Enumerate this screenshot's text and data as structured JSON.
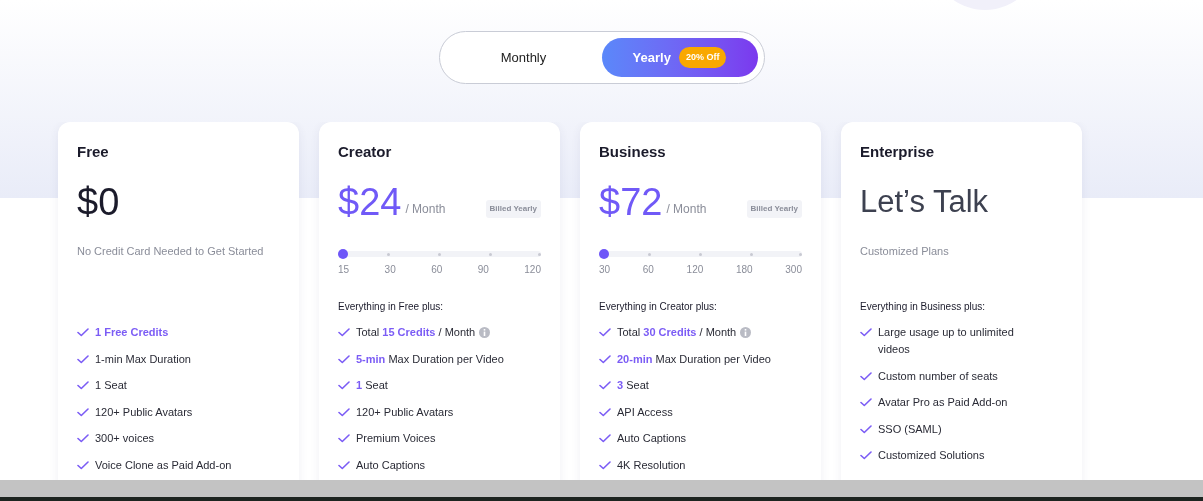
{
  "billing_toggle": {
    "options": [
      {
        "label": "Monthly",
        "selected": false
      },
      {
        "label": "Yearly",
        "selected": true,
        "badge": "20% Off"
      }
    ]
  },
  "plans": [
    {
      "name": "Free",
      "price": {
        "kind": "amount",
        "currency": "$",
        "amount": "0"
      },
      "subtitle": "No Credit Card Needed to Get Started",
      "features": [
        {
          "parts": [
            {
              "text": "1 Free Credits",
              "highlight": true
            }
          ]
        },
        {
          "parts": [
            {
              "text": "1-min Max Duration"
            }
          ]
        },
        {
          "parts": [
            {
              "text": "1 Seat"
            }
          ]
        },
        {
          "parts": [
            {
              "text": "120+ Public Avatars"
            }
          ]
        },
        {
          "parts": [
            {
              "text": "300+ voices"
            }
          ]
        },
        {
          "parts": [
            {
              "text": "Voice Clone as Paid Add-on"
            }
          ]
        }
      ]
    },
    {
      "name": "Creator",
      "price": {
        "kind": "amount",
        "currency": "$",
        "amount": "24",
        "period": "/ Month",
        "note": "Billed Yearly",
        "highlight": true
      },
      "slider": {
        "level": 0,
        "labels": [
          "15",
          "30",
          "60",
          "90",
          "120"
        ]
      },
      "includes": "Everything in Free plus:",
      "features": [
        {
          "parts": [
            {
              "text": "Total "
            },
            {
              "text": "15 Credits",
              "highlight": true
            },
            {
              "text": " / Month"
            }
          ],
          "info": true
        },
        {
          "parts": [
            {
              "text": "5-min",
              "highlight": true
            },
            {
              "text": " Max Duration per Video"
            }
          ]
        },
        {
          "parts": [
            {
              "text": "1",
              "highlight": true
            },
            {
              "text": " Seat"
            }
          ]
        },
        {
          "parts": [
            {
              "text": "120+ Public Avatars"
            }
          ]
        },
        {
          "parts": [
            {
              "text": "Premium Voices"
            }
          ]
        },
        {
          "parts": [
            {
              "text": "Auto Captions"
            }
          ]
        }
      ]
    },
    {
      "name": "Business",
      "price": {
        "kind": "amount",
        "currency": "$",
        "amount": "72",
        "period": "/ Month",
        "note": "Billed Yearly",
        "highlight": true
      },
      "slider": {
        "level": 0,
        "labels": [
          "30",
          "60",
          "120",
          "180",
          "300"
        ]
      },
      "includes": "Everything in Creator plus:",
      "features": [
        {
          "parts": [
            {
              "text": "Total "
            },
            {
              "text": "30 Credits",
              "highlight": true
            },
            {
              "text": " / Month"
            }
          ],
          "info": true
        },
        {
          "parts": [
            {
              "text": "20-min",
              "highlight": true
            },
            {
              "text": " Max Duration per Video"
            }
          ]
        },
        {
          "parts": [
            {
              "text": "3",
              "highlight": true
            },
            {
              "text": " Seat"
            }
          ]
        },
        {
          "parts": [
            {
              "text": "API Access"
            }
          ]
        },
        {
          "parts": [
            {
              "text": "Auto Captions"
            }
          ]
        },
        {
          "parts": [
            {
              "text": "4K Resolution"
            }
          ]
        }
      ]
    },
    {
      "name": "Enterprise",
      "price": {
        "kind": "text",
        "text": "Let’s Talk"
      },
      "subtitle": "Customized Plans",
      "includes": "Everything in Business plus:",
      "features": [
        {
          "parts": [
            {
              "text": "Large usage up to unlimited videos"
            }
          ]
        },
        {
          "parts": [
            {
              "text": "Custom number of seats"
            }
          ]
        },
        {
          "parts": [
            {
              "text": "Avatar Pro as Paid Add-on"
            }
          ]
        },
        {
          "parts": [
            {
              "text": "SSO (SAML)"
            }
          ]
        },
        {
          "parts": [
            {
              "text": "Customized Solutions"
            }
          ]
        }
      ]
    }
  ]
}
